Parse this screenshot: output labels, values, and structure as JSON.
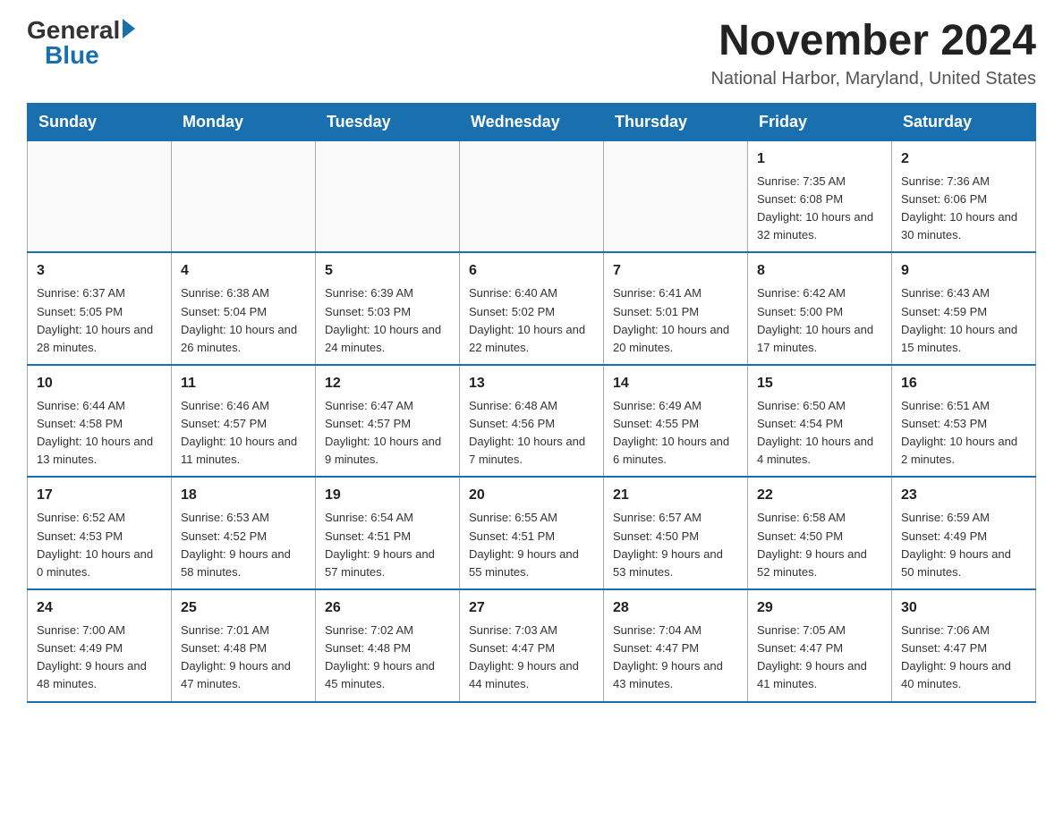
{
  "logo": {
    "general": "General",
    "blue": "Blue",
    "arrow": "▶"
  },
  "title": "November 2024",
  "location": "National Harbor, Maryland, United States",
  "weekdays": [
    "Sunday",
    "Monday",
    "Tuesday",
    "Wednesday",
    "Thursday",
    "Friday",
    "Saturday"
  ],
  "weeks": [
    [
      {
        "day": "",
        "info": ""
      },
      {
        "day": "",
        "info": ""
      },
      {
        "day": "",
        "info": ""
      },
      {
        "day": "",
        "info": ""
      },
      {
        "day": "",
        "info": ""
      },
      {
        "day": "1",
        "info": "Sunrise: 7:35 AM\nSunset: 6:08 PM\nDaylight: 10 hours and 32 minutes."
      },
      {
        "day": "2",
        "info": "Sunrise: 7:36 AM\nSunset: 6:06 PM\nDaylight: 10 hours and 30 minutes."
      }
    ],
    [
      {
        "day": "3",
        "info": "Sunrise: 6:37 AM\nSunset: 5:05 PM\nDaylight: 10 hours and 28 minutes."
      },
      {
        "day": "4",
        "info": "Sunrise: 6:38 AM\nSunset: 5:04 PM\nDaylight: 10 hours and 26 minutes."
      },
      {
        "day": "5",
        "info": "Sunrise: 6:39 AM\nSunset: 5:03 PM\nDaylight: 10 hours and 24 minutes."
      },
      {
        "day": "6",
        "info": "Sunrise: 6:40 AM\nSunset: 5:02 PM\nDaylight: 10 hours and 22 minutes."
      },
      {
        "day": "7",
        "info": "Sunrise: 6:41 AM\nSunset: 5:01 PM\nDaylight: 10 hours and 20 minutes."
      },
      {
        "day": "8",
        "info": "Sunrise: 6:42 AM\nSunset: 5:00 PM\nDaylight: 10 hours and 17 minutes."
      },
      {
        "day": "9",
        "info": "Sunrise: 6:43 AM\nSunset: 4:59 PM\nDaylight: 10 hours and 15 minutes."
      }
    ],
    [
      {
        "day": "10",
        "info": "Sunrise: 6:44 AM\nSunset: 4:58 PM\nDaylight: 10 hours and 13 minutes."
      },
      {
        "day": "11",
        "info": "Sunrise: 6:46 AM\nSunset: 4:57 PM\nDaylight: 10 hours and 11 minutes."
      },
      {
        "day": "12",
        "info": "Sunrise: 6:47 AM\nSunset: 4:57 PM\nDaylight: 10 hours and 9 minutes."
      },
      {
        "day": "13",
        "info": "Sunrise: 6:48 AM\nSunset: 4:56 PM\nDaylight: 10 hours and 7 minutes."
      },
      {
        "day": "14",
        "info": "Sunrise: 6:49 AM\nSunset: 4:55 PM\nDaylight: 10 hours and 6 minutes."
      },
      {
        "day": "15",
        "info": "Sunrise: 6:50 AM\nSunset: 4:54 PM\nDaylight: 10 hours and 4 minutes."
      },
      {
        "day": "16",
        "info": "Sunrise: 6:51 AM\nSunset: 4:53 PM\nDaylight: 10 hours and 2 minutes."
      }
    ],
    [
      {
        "day": "17",
        "info": "Sunrise: 6:52 AM\nSunset: 4:53 PM\nDaylight: 10 hours and 0 minutes."
      },
      {
        "day": "18",
        "info": "Sunrise: 6:53 AM\nSunset: 4:52 PM\nDaylight: 9 hours and 58 minutes."
      },
      {
        "day": "19",
        "info": "Sunrise: 6:54 AM\nSunset: 4:51 PM\nDaylight: 9 hours and 57 minutes."
      },
      {
        "day": "20",
        "info": "Sunrise: 6:55 AM\nSunset: 4:51 PM\nDaylight: 9 hours and 55 minutes."
      },
      {
        "day": "21",
        "info": "Sunrise: 6:57 AM\nSunset: 4:50 PM\nDaylight: 9 hours and 53 minutes."
      },
      {
        "day": "22",
        "info": "Sunrise: 6:58 AM\nSunset: 4:50 PM\nDaylight: 9 hours and 52 minutes."
      },
      {
        "day": "23",
        "info": "Sunrise: 6:59 AM\nSunset: 4:49 PM\nDaylight: 9 hours and 50 minutes."
      }
    ],
    [
      {
        "day": "24",
        "info": "Sunrise: 7:00 AM\nSunset: 4:49 PM\nDaylight: 9 hours and 48 minutes."
      },
      {
        "day": "25",
        "info": "Sunrise: 7:01 AM\nSunset: 4:48 PM\nDaylight: 9 hours and 47 minutes."
      },
      {
        "day": "26",
        "info": "Sunrise: 7:02 AM\nSunset: 4:48 PM\nDaylight: 9 hours and 45 minutes."
      },
      {
        "day": "27",
        "info": "Sunrise: 7:03 AM\nSunset: 4:47 PM\nDaylight: 9 hours and 44 minutes."
      },
      {
        "day": "28",
        "info": "Sunrise: 7:04 AM\nSunset: 4:47 PM\nDaylight: 9 hours and 43 minutes."
      },
      {
        "day": "29",
        "info": "Sunrise: 7:05 AM\nSunset: 4:47 PM\nDaylight: 9 hours and 41 minutes."
      },
      {
        "day": "30",
        "info": "Sunrise: 7:06 AM\nSunset: 4:47 PM\nDaylight: 9 hours and 40 minutes."
      }
    ]
  ]
}
